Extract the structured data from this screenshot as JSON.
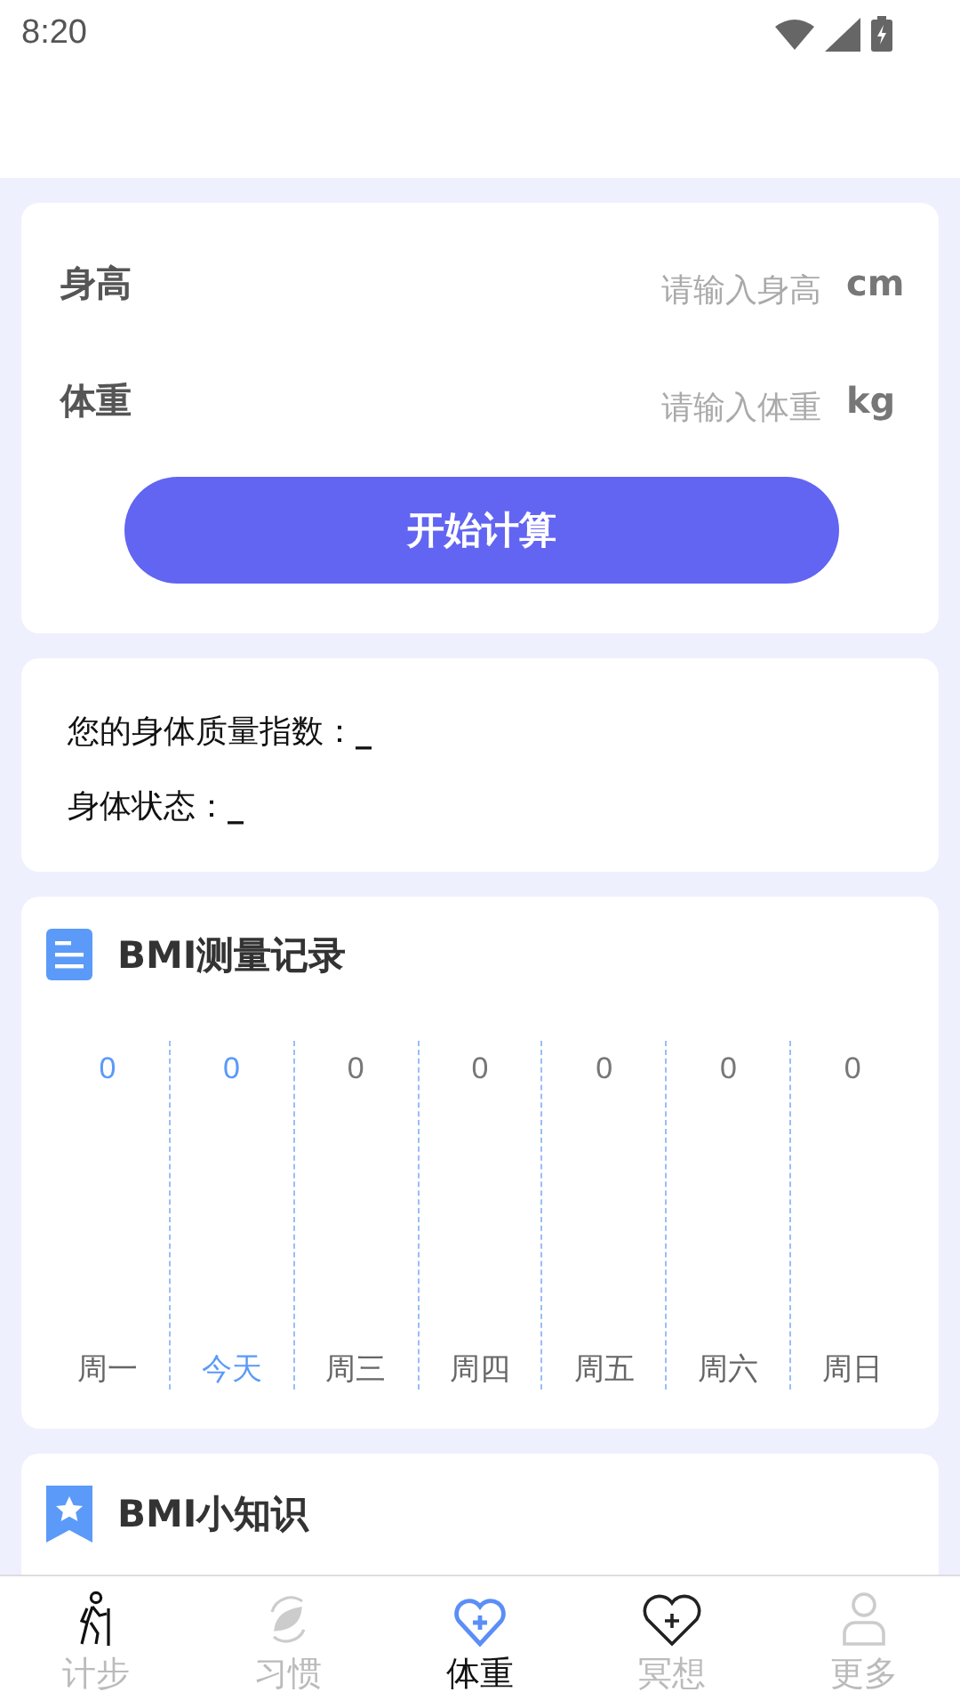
{
  "status_bar": {
    "time": "8:20"
  },
  "form": {
    "fields": [
      {
        "label": "身高",
        "placeholder": "请输入身高",
        "unit": "cm"
      },
      {
        "label": "体重",
        "placeholder": "请输入体重",
        "unit": "kg"
      }
    ],
    "button": "开始计算"
  },
  "result": {
    "lines": [
      {
        "label": "您的身体质量指数：",
        "value": "_"
      },
      {
        "label": "身体状态：",
        "value": "_"
      }
    ]
  },
  "record": {
    "title": "BMI测量记录",
    "days": [
      {
        "value": "0",
        "label": "周一",
        "value_highlighted": true,
        "selected": false
      },
      {
        "value": "0",
        "label": "今天",
        "value_highlighted": true,
        "selected": true
      },
      {
        "value": "0",
        "label": "周三",
        "value_highlighted": false,
        "selected": false
      },
      {
        "value": "0",
        "label": "周四",
        "value_highlighted": false,
        "selected": false
      },
      {
        "value": "0",
        "label": "周五",
        "value_highlighted": false,
        "selected": false
      },
      {
        "value": "0",
        "label": "周六",
        "value_highlighted": false,
        "selected": false
      },
      {
        "value": "0",
        "label": "周日",
        "value_highlighted": false,
        "selected": false
      }
    ]
  },
  "knowledge": {
    "title": "BMI小知识"
  },
  "tab_bar": [
    {
      "label": "计步",
      "kind": "hiker",
      "selected": false
    },
    {
      "label": "习惯",
      "kind": "leaf",
      "selected": false
    },
    {
      "label": "体重",
      "kind": "heart",
      "selected": true
    },
    {
      "label": "冥想",
      "kind": "heart-outline",
      "selected": false
    },
    {
      "label": "更多",
      "kind": "person",
      "selected": false
    }
  ]
}
